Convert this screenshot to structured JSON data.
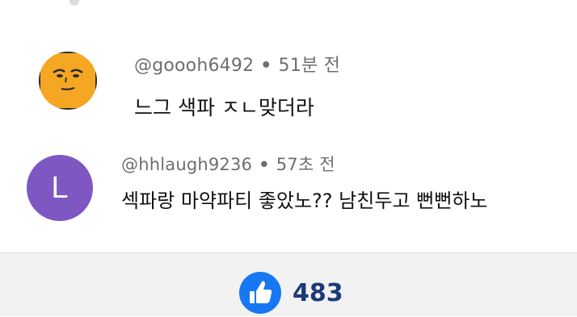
{
  "comments": [
    {
      "handle": "@goooh6492",
      "separator": "•",
      "time": "51분 전",
      "text": "느그 색파 ㅈㄴ맞더라",
      "avatar": {
        "type": "emoji-face",
        "color": "#f5a623"
      }
    },
    {
      "handle": "@hhlaugh9236",
      "separator": "•",
      "time": "57초 전",
      "text": "섹파랑 마약파티 좋았노?? 남친두고 뻔뻔하노",
      "avatar": {
        "type": "letter",
        "letter": "L",
        "color": "#7e57c2"
      }
    }
  ],
  "footer": {
    "like_icon": "thumbs-up-icon",
    "like_color": "#1877f2",
    "like_count": "483"
  }
}
